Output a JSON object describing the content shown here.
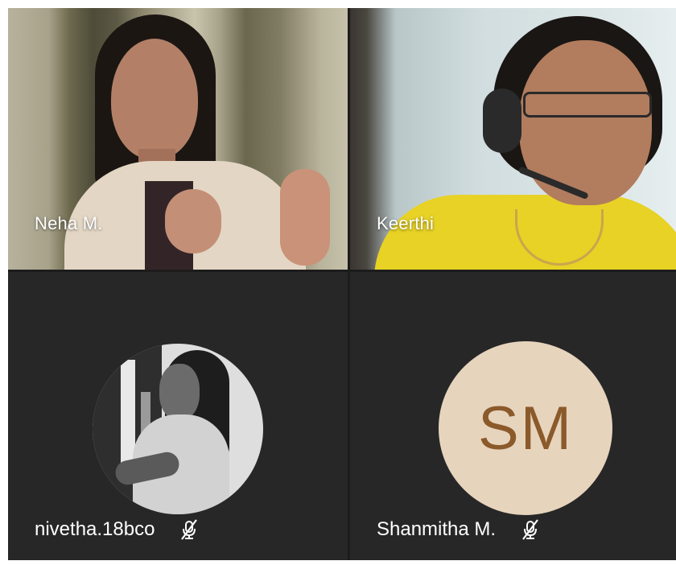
{
  "participants": [
    {
      "name": "Neha M.",
      "type": "video"
    },
    {
      "name": "Keerthi",
      "type": "video"
    },
    {
      "name": "nivetha.18bco",
      "type": "avatar-photo",
      "muted": true
    },
    {
      "name": "Shanmitha M.",
      "type": "avatar-initials",
      "initials": "SM",
      "muted": true
    }
  ],
  "colors": {
    "tile_bg": "#272727",
    "initials_bg": "#e7d4bd",
    "initials_text": "#8b5a2b"
  },
  "icons": {
    "mute": "mic-off-icon"
  }
}
